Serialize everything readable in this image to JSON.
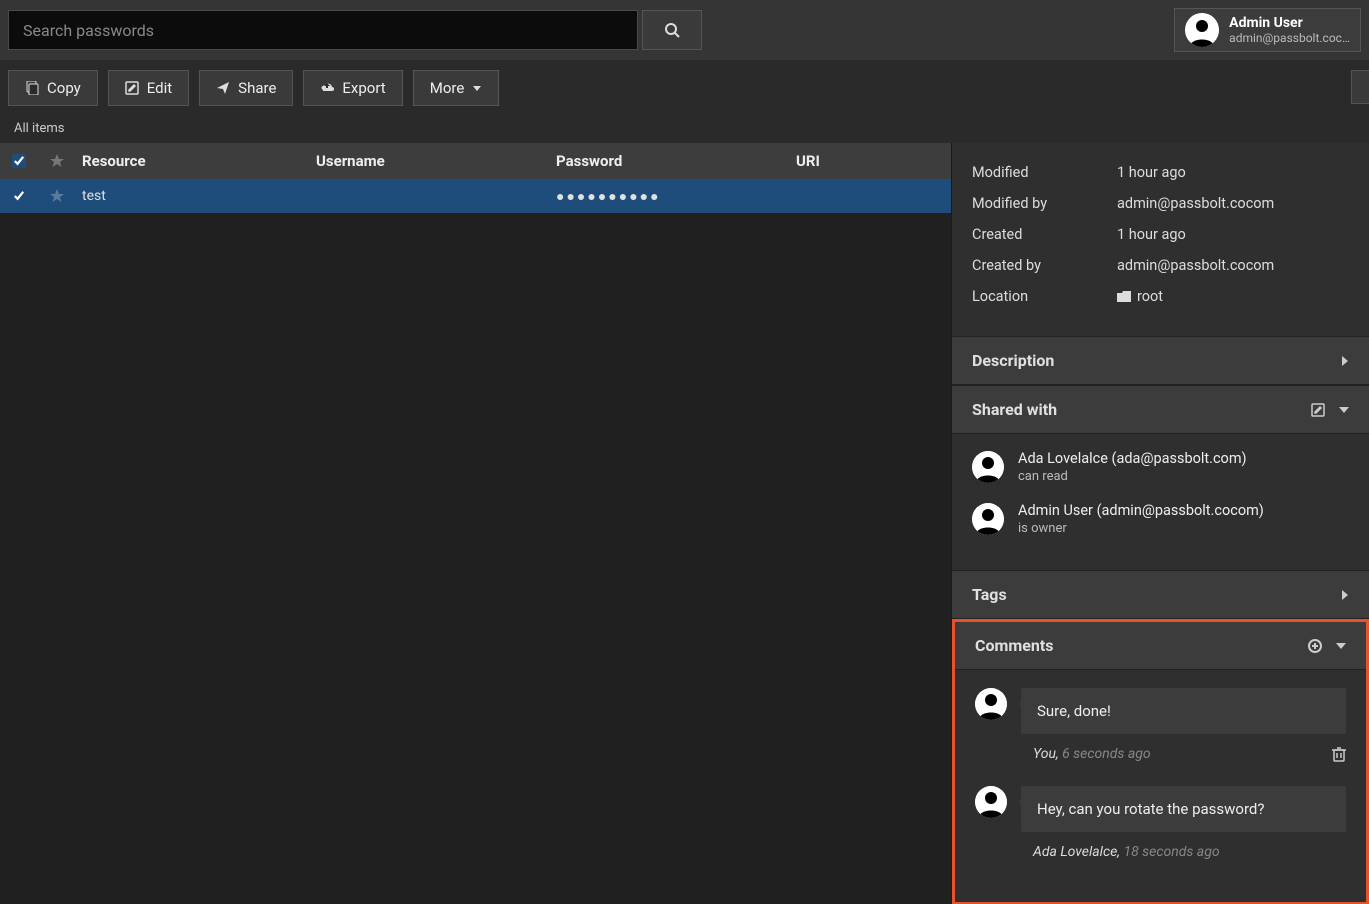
{
  "search": {
    "placeholder": "Search passwords"
  },
  "user": {
    "name": "Admin User",
    "email": "admin@passbolt.coc…"
  },
  "toolbar": {
    "copy": "Copy",
    "edit": "Edit",
    "share": "Share",
    "export": "Export",
    "more": "More"
  },
  "breadcrumb": "All items",
  "table": {
    "headers": {
      "resource": "Resource",
      "username": "Username",
      "password": "Password",
      "uri": "URI"
    },
    "rows": [
      {
        "resource": "test",
        "username": "",
        "password_mask": "●●●●●●●●●●",
        "uri": ""
      }
    ]
  },
  "meta": {
    "modified_label": "Modified",
    "modified_value": "1 hour ago",
    "modified_by_label": "Modified by",
    "modified_by_value": "admin@passbolt.cocom",
    "created_label": "Created",
    "created_value": "1 hour ago",
    "created_by_label": "Created by",
    "created_by_value": "admin@passbolt.cocom",
    "location_label": "Location",
    "location_value": "root"
  },
  "sections": {
    "description": "Description",
    "shared_with": "Shared with",
    "tags": "Tags",
    "comments": "Comments"
  },
  "shared": [
    {
      "line1": "Ada Lovelalce (ada@passbolt.com)",
      "line2": "can read"
    },
    {
      "line1": "Admin User (admin@passbolt.cocom)",
      "line2": "is owner"
    }
  ],
  "comments": [
    {
      "text": "Sure, done!",
      "author": "You,",
      "time": "6 seconds ago",
      "deletable": true
    },
    {
      "text": "Hey, can you rotate the password?",
      "author": "Ada Lovelalce,",
      "time": "18 seconds ago",
      "deletable": false
    }
  ]
}
